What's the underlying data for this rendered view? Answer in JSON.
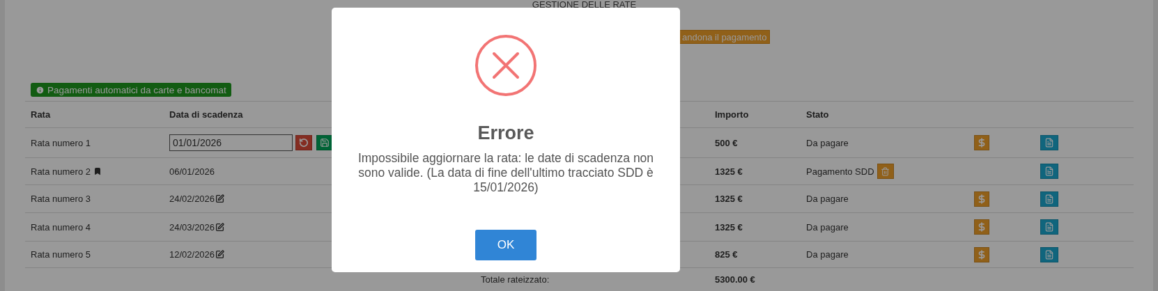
{
  "page": {
    "title": "GESTIONE DELLE RATE",
    "action_button": "andona il pagamento",
    "info_badge": "Pagamenti automatici da carte e bancomat"
  },
  "table": {
    "columns": [
      "Rata",
      "Data di scadenza",
      "Importo",
      "Stato"
    ],
    "rows": [
      {
        "rata": "Rata numero 1",
        "bookmarked": false,
        "due": {
          "kind": "input",
          "value": "01/01/2026"
        },
        "amount": "500 €",
        "status": "Da pagare",
        "deletable": false,
        "payable": true
      },
      {
        "rata": "Rata numero 2",
        "bookmarked": true,
        "due": {
          "kind": "text",
          "value": "06/01/2026"
        },
        "amount": "1325 €",
        "status": "Pagamento SDD",
        "deletable": true,
        "payable": false
      },
      {
        "rata": "Rata numero 3",
        "bookmarked": false,
        "due": {
          "kind": "editable",
          "value": "24/02/2026"
        },
        "amount": "1325 €",
        "status": "Da pagare",
        "deletable": false,
        "payable": true
      },
      {
        "rata": "Rata numero 4",
        "bookmarked": false,
        "due": {
          "kind": "editable",
          "value": "24/03/2026"
        },
        "amount": "1325 €",
        "status": "Da pagare",
        "deletable": false,
        "payable": true
      },
      {
        "rata": "Rata numero 5",
        "bookmarked": false,
        "due": {
          "kind": "editable",
          "value": "12/02/2026"
        },
        "amount": "825 €",
        "status": "Da pagare",
        "deletable": false,
        "payable": true
      }
    ],
    "total_label": "Totale rateizzato:",
    "total": "5300.00 €"
  },
  "dialog": {
    "title": "Errore",
    "message": "Impossibile aggiornare la rata: le date di scadenza non sono valide. (La data di fine dell'ultimo tracciato SDD è 15/01/2026)",
    "button": "OK"
  }
}
